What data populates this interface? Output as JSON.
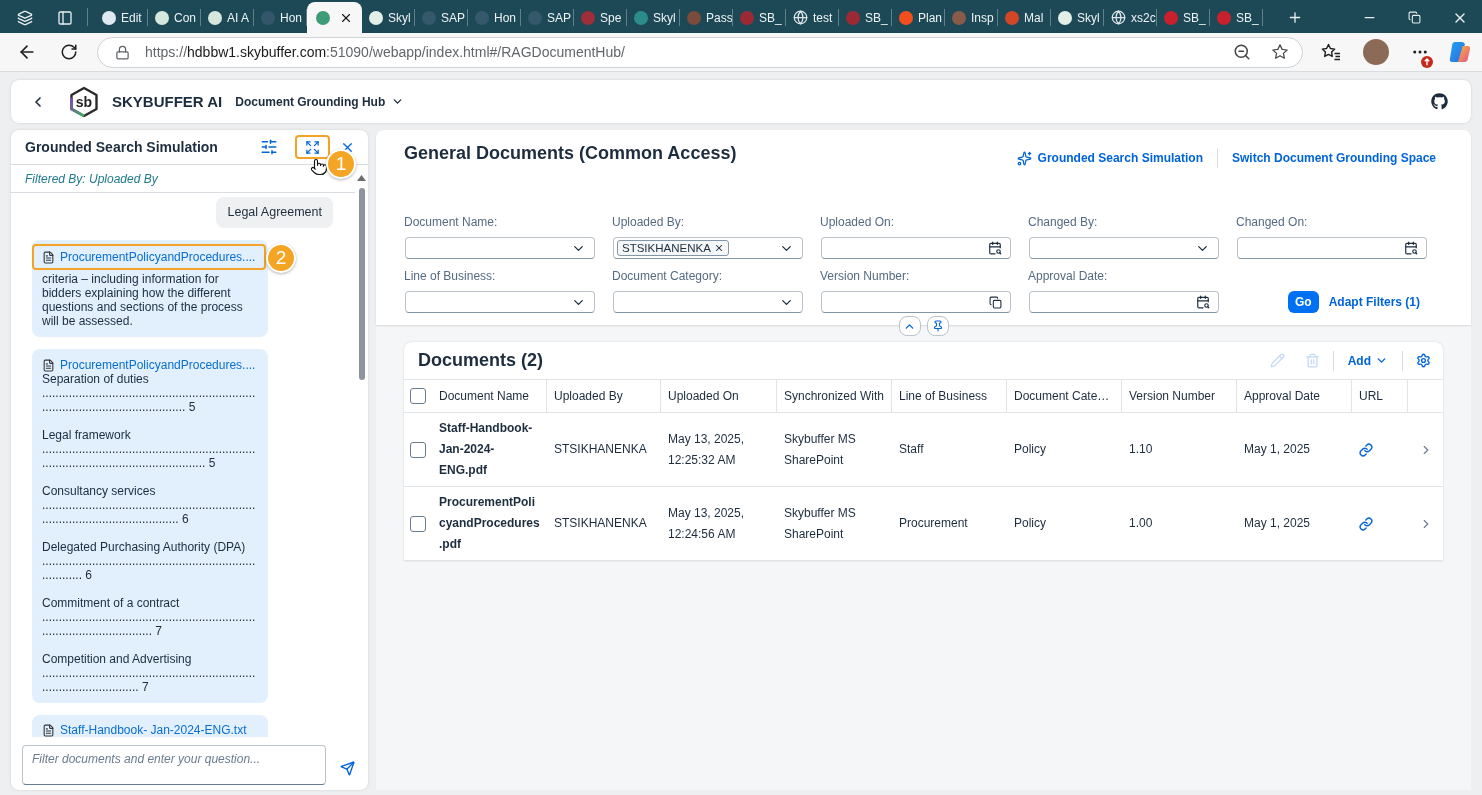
{
  "browser": {
    "tabs": [
      {
        "label": "Edit",
        "selected": false,
        "kind": "site",
        "color": "#dfe9f2"
      },
      {
        "label": "Con",
        "selected": false,
        "kind": "site",
        "color": "#d6e8de"
      },
      {
        "label": "AI A",
        "selected": false,
        "kind": "site",
        "color": "#d6e8de"
      },
      {
        "label": "Hon",
        "selected": false,
        "kind": "site",
        "color": "#34566a"
      },
      {
        "selected": true,
        "kind": "site",
        "color": "#3f9c78"
      },
      {
        "label": "Skyl",
        "selected": false,
        "kind": "site",
        "color": "#e2f0e8"
      },
      {
        "label": "SAP",
        "selected": false,
        "kind": "site",
        "color": "#35586a"
      },
      {
        "label": "Hon",
        "selected": false,
        "kind": "site",
        "color": "#35586a"
      },
      {
        "label": "SAP",
        "selected": false,
        "kind": "site",
        "color": "#35586a"
      },
      {
        "label": "Spe",
        "selected": false,
        "kind": "site",
        "color": "#9e2f3a"
      },
      {
        "label": "Skyl",
        "selected": false,
        "kind": "site",
        "color": "#2b8c8a"
      },
      {
        "label": "Pass",
        "selected": false,
        "kind": "site",
        "color": "#7b4b3c"
      },
      {
        "label": "SB_",
        "selected": false,
        "kind": "site",
        "color": "#9c2a35"
      },
      {
        "label": "test",
        "selected": false,
        "kind": "globe"
      },
      {
        "label": "SB_",
        "selected": false,
        "kind": "site",
        "color": "#9c2a35"
      },
      {
        "label": "Plan",
        "selected": false,
        "kind": "site",
        "color": "#f24e1e"
      },
      {
        "label": "Insp",
        "selected": false,
        "kind": "site",
        "color": "#8a5a4a"
      },
      {
        "label": "Mal",
        "selected": false,
        "kind": "site",
        "color": "#d24726"
      },
      {
        "label": "Skyl",
        "selected": false,
        "kind": "site",
        "color": "#e2f0e8"
      },
      {
        "label": "xs2c",
        "selected": false,
        "kind": "globe"
      },
      {
        "label": "SB_",
        "selected": false,
        "kind": "site",
        "color": "#c8202c"
      },
      {
        "label": "SB_",
        "selected": false,
        "kind": "site",
        "color": "#c8202c"
      }
    ],
    "url": "https://**hdbbw1.skybuffer.com**:51090/webapp/index.html#/RAGDocumentHub/"
  },
  "shell": {
    "logo_text": "sb",
    "brand": "SKYBUFFER AI",
    "app_title": "Document Grounding Hub"
  },
  "simulation_panel": {
    "title": "Grounded Search Simulation",
    "expand_callout": "1",
    "filter_note": "Filtered By: Uploaded By",
    "messages": [
      {
        "kind": "question",
        "text": "Legal Agreement"
      },
      {
        "kind": "answer",
        "source": "ProcurementPolicyandProcedures....",
        "callout": "2",
        "paragraphs": [
          "criteria – including information for bidders explaining how the different questions and sections of the process will be assessed."
        ]
      },
      {
        "kind": "answer",
        "source": "ProcurementPolicyandProcedures....",
        "paragraphs": [
          "Separation of duties ........................................................................................................... 5",
          "Legal framework ................................................................................................................. 5",
          "Consultancy services ......................................................................................................... 6",
          "Delegated Purchasing Authority (DPA) ............................................................................ 6",
          "Commitment of a contract ................................................................................................. 7",
          "Competition and Advertising ............................................................................................. 7"
        ]
      },
      {
        "kind": "answer",
        "source": "Staff-Handbook- Jan-2024-ENG.txt"
      }
    ],
    "input": {
      "placeholder": "Filter documents and enter your question..."
    }
  },
  "documents_page": {
    "title": "General Documents (Common Access)",
    "actions": [
      {
        "kind": "ai",
        "label": "Grounded Search Simulation"
      },
      {
        "kind": "plain",
        "label": "Switch Document Grounding Space"
      }
    ],
    "filters": [
      {
        "label": "Document Name:",
        "kind": "select"
      },
      {
        "label": "Uploaded By:",
        "kind": "multi",
        "tokens": [
          "STSIKHANENKA"
        ]
      },
      {
        "label": "Uploaded On:",
        "kind": "date"
      },
      {
        "label": "Changed By:",
        "kind": "select"
      },
      {
        "label": "Changed On:",
        "kind": "date"
      },
      {
        "label": "Line of Business:",
        "kind": "select"
      },
      {
        "label": "Document Category:",
        "kind": "select"
      },
      {
        "label": "Version Number:",
        "kind": "value-help"
      },
      {
        "label": "Approval Date:",
        "kind": "date"
      }
    ],
    "go_button": "Go",
    "adapt_filters": "Adapt Filters (1)"
  },
  "documents_table": {
    "title": "Documents (2)",
    "toolbar": [
      {
        "kind": "edit",
        "disabled": true
      },
      {
        "kind": "delete",
        "disabled": true
      },
      {
        "kind": "add",
        "label": "Add",
        "disabled": false
      },
      {
        "kind": "settings",
        "disabled": false
      }
    ],
    "select_all": {
      "checked": false
    },
    "columns": [
      "Document Name",
      "Uploaded By",
      "Uploaded On",
      "Synchronized With",
      "Line of Business",
      "Document Cate…",
      "Version Number",
      "Approval Date",
      "URL"
    ],
    "rows": [
      {
        "selected": false,
        "cells": [
          "Staff-Handbook-Jan-2024-ENG.pdf",
          "STSIKHANENKA",
          "May 13, 2025, 12:25:32 AM",
          "Skybuffer MS SharePoint",
          "Staff",
          "Policy",
          "1.10",
          "May 1, 2025"
        ]
      },
      {
        "selected": false,
        "cells": [
          "ProcurementPolicyandProcedures.pdf",
          "STSIKHANENKA",
          "May 13, 2025, 12:24:56 AM",
          "Skybuffer MS SharePoint",
          "Procurement",
          "Policy",
          "1.00",
          "May 1, 2025"
        ]
      }
    ]
  }
}
